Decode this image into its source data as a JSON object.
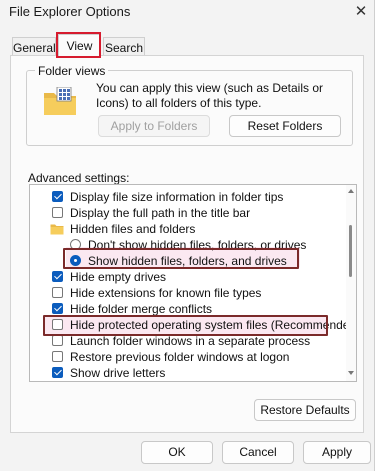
{
  "window": {
    "title": "File Explorer Options",
    "close_glyph": "✕"
  },
  "tabs": [
    {
      "label": "General"
    },
    {
      "label": "View"
    },
    {
      "label": "Search"
    }
  ],
  "folder_views": {
    "title": "Folder views",
    "description": "You can apply this view (such as Details or Icons) to all folders of this type.",
    "apply_label": "Apply to Folders",
    "reset_label": "Reset Folders"
  },
  "advanced": {
    "label": "Advanced settings:",
    "items": [
      {
        "type": "checkbox",
        "label": "Display file size information in folder tips",
        "checked": true
      },
      {
        "type": "checkbox",
        "label": "Display the full path in the title bar",
        "checked": false
      },
      {
        "type": "folder",
        "label": "Hidden files and folders"
      },
      {
        "type": "radio",
        "label": "Don't show hidden files, folders, or drives",
        "checked": false
      },
      {
        "type": "radio",
        "label": "Show hidden files, folders, and drives",
        "checked": true
      },
      {
        "type": "checkbox",
        "label": "Hide empty drives",
        "checked": true
      },
      {
        "type": "checkbox",
        "label": "Hide extensions for known file types",
        "checked": false
      },
      {
        "type": "checkbox",
        "label": "Hide folder merge conflicts",
        "checked": true
      },
      {
        "type": "checkbox",
        "label": "Hide protected operating system files (Recommended)",
        "checked": false
      },
      {
        "type": "checkbox",
        "label": "Launch folder windows in a separate process",
        "checked": false
      },
      {
        "type": "checkbox",
        "label": "Restore previous folder windows at logon",
        "checked": false
      },
      {
        "type": "checkbox",
        "label": "Show drive letters",
        "checked": true
      }
    ]
  },
  "restore_defaults_label": "Restore Defaults",
  "footer": {
    "ok": "OK",
    "cancel": "Cancel",
    "apply": "Apply"
  },
  "colors": {
    "accent": "#0b5cbd",
    "highlight_red": "#d61b2e",
    "highlight_dark": "#7b2a2a"
  }
}
